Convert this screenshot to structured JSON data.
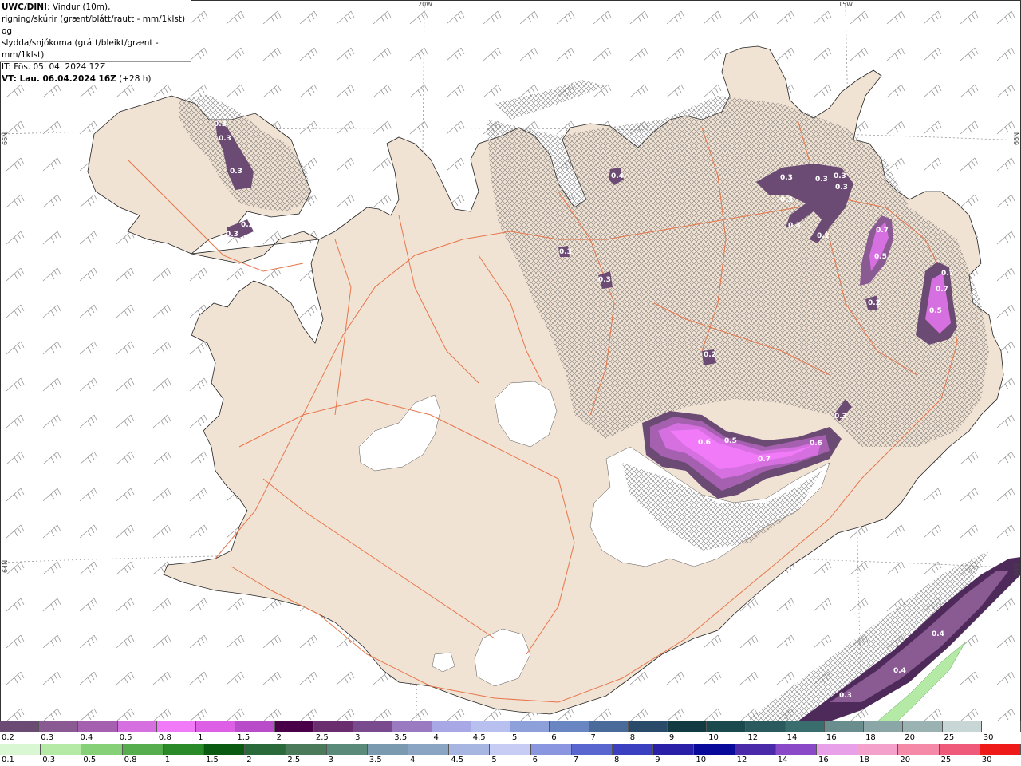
{
  "header": {
    "model": "UWC/DINI",
    "line1_rest": ": Vindur (10m),",
    "line2": "rigning/skúrir (grænt/blátt/rautt - mm/1klst) og",
    "line3": "slydda/snjókoma (grátt/bleikt/grænt - mm/1klst)",
    "issue_time": "IT: Fös. 05. 04. 2024 12Z",
    "valid_prefix": "VT: Lau. 06.04.2024 16Z",
    "valid_suffix": " (+28 h)"
  },
  "grid_labels": {
    "lon_20w": "20W",
    "lon_15w": "15W",
    "lat_66n_left": "66N",
    "lat_66n_right": "66N",
    "lat_64n_left": "64N",
    "lat_64n_right": "64N"
  },
  "precip_labels": [
    "0.3",
    "0.3",
    "0.3",
    "0.3",
    "0.2",
    "0.4",
    "0.3",
    "0.3",
    "0.3",
    "0.3",
    "0.3",
    "0.3",
    "0.2",
    "0.7",
    "0.5",
    "0.7",
    "0.7",
    "0.5",
    "0.2",
    "0.3",
    "0.2",
    "0.3",
    "0.6",
    "0.5",
    "0.7",
    "0.6",
    "0.3",
    "0.4",
    "0.4",
    "0.3"
  ],
  "legend_snow": {
    "labels": [
      "0.2",
      "0.3",
      "0.4",
      "0.5",
      "0.8",
      "1",
      "1.5",
      "2",
      "2.5",
      "3",
      "3.5",
      "4",
      "4.5",
      "5",
      "6",
      "7",
      "8",
      "9",
      "10",
      "12",
      "14",
      "16",
      "18",
      "20",
      "25",
      "30"
    ],
    "colors": [
      "#6b4a73",
      "#8a5a92",
      "#a561b0",
      "#d66fe0",
      "#f07af8",
      "#dc5fe6",
      "#b84cc9",
      "#4a0048",
      "#6a2e6e",
      "#7a4a8e",
      "#9a7ac0",
      "#a8a8e6",
      "#b8c0f0",
      "#8ea0da",
      "#6a86c2",
      "#4a6a9a",
      "#2a4a6a",
      "#123a42",
      "#1a4a4e",
      "#2a5a5e",
      "#3a6e6e",
      "#6a8e8e",
      "#8aa6a6",
      "#9ab2b2",
      "#c8d6d6",
      "#ffffff"
    ]
  },
  "legend_rain": {
    "labels": [
      "0.1",
      "0.3",
      "0.5",
      "0.8",
      "1",
      "1.5",
      "2",
      "2.5",
      "3",
      "3.5",
      "4",
      "4.5",
      "5",
      "6",
      "7",
      "8",
      "9",
      "10",
      "12",
      "14",
      "16",
      "18",
      "20",
      "25",
      "30"
    ],
    "colors": [
      "#d9f7d2",
      "#b4eaa6",
      "#86d178",
      "#55ad4e",
      "#2a8a2a",
      "#0a5a12",
      "#2a6a3a",
      "#4a7a5a",
      "#5a8a7a",
      "#7a9ab0",
      "#8aa4c4",
      "#a6b6e0",
      "#c6ccf4",
      "#8a96e0",
      "#5a66d0",
      "#3a40c0",
      "#2a20a8",
      "#0a0a9a",
      "#4a2aa8",
      "#8a4ac8",
      "#e8a0e8",
      "#f4a2cc",
      "#f48aa8",
      "#f05a7a",
      "#ee1a1a"
    ]
  }
}
